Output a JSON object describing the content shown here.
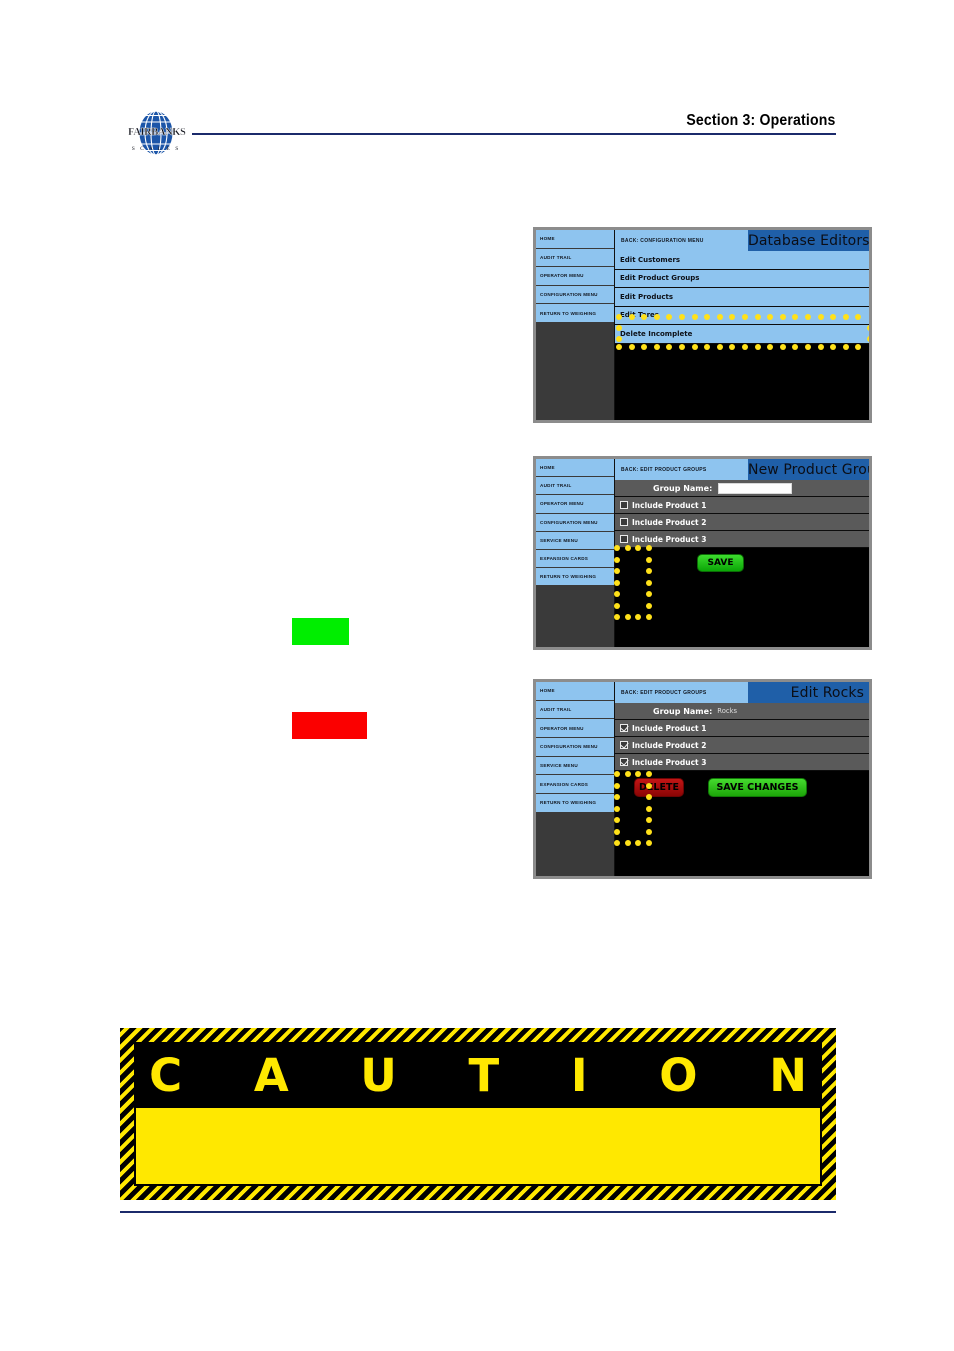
{
  "header": {
    "logo_wordmark": "FAIRBANKS",
    "logo_sub": "S C A L E S",
    "section_title": "Section 3:  Operations"
  },
  "swatches": {
    "green": "#00ee00",
    "red": "#fb0000"
  },
  "devices": [
    {
      "name": "database-editors",
      "sidebar": [
        "HOME",
        "AUDIT TRAIL",
        "OPERATOR MENU",
        "CONFIGURATION MENU",
        "RETURN TO WEIGHING"
      ],
      "back_label": "BACK: CONFIGURATION MENU",
      "screen_title": "Database Editors",
      "menu_items": [
        "Edit Customers",
        "Edit Product Groups",
        "Edit Products",
        "Edit Tares",
        "Delete Incomplete"
      ]
    },
    {
      "name": "new-product-group",
      "sidebar": [
        "HOME",
        "AUDIT TRAIL",
        "OPERATOR MENU",
        "CONFIGURATION MENU",
        "SERVICE MENU",
        "EXPANSION CARDS",
        "RETURN TO WEIGHING"
      ],
      "back_label": "BACK: EDIT PRODUCT GROUPS",
      "screen_title": "New Product Group",
      "group_name_label": "Group Name:",
      "group_name_value": "",
      "checkboxes": [
        {
          "label": "Include Product 1",
          "checked": false
        },
        {
          "label": "Include Product 2",
          "checked": false
        },
        {
          "label": "Include Product 3",
          "checked": false
        }
      ],
      "save_label": "SAVE"
    },
    {
      "name": "edit-rocks",
      "sidebar": [
        "HOME",
        "AUDIT TRAIL",
        "OPERATOR MENU",
        "CONFIGURATION MENU",
        "SERVICE MENU",
        "EXPANSION CARDS",
        "RETURN TO WEIGHING"
      ],
      "back_label": "BACK: EDIT PRODUCT GROUPS",
      "screen_title": "Edit Rocks",
      "group_name_label": "Group Name:",
      "group_name_value": "Rocks",
      "checkboxes": [
        {
          "label": "Include Product 1",
          "checked": true
        },
        {
          "label": "Include Product 2",
          "checked": true
        },
        {
          "label": "Include Product 3",
          "checked": true
        }
      ],
      "delete_label": "DELETE",
      "save_changes_label": "SAVE CHANGES"
    }
  ],
  "caution": {
    "title": "C A U T I O N",
    "body": ""
  }
}
